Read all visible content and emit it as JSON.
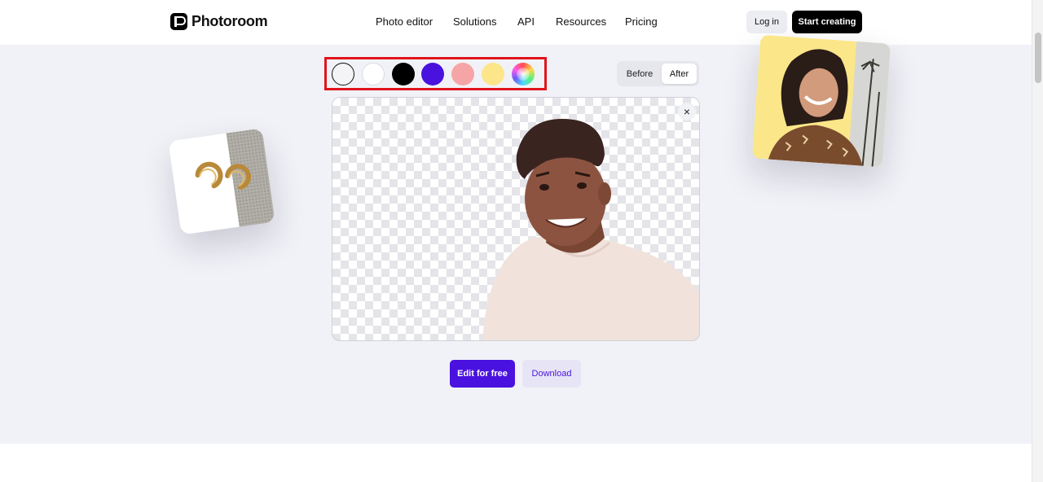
{
  "header": {
    "brand": "Photoroom",
    "nav": [
      "Photo editor",
      "Solutions",
      "API",
      "Resources",
      "Pricing"
    ],
    "login_label": "Log in",
    "start_label": "Start creating"
  },
  "editor": {
    "swatches": [
      {
        "name": "transparent",
        "color": "transparent"
      },
      {
        "name": "white",
        "color": "#ffffff"
      },
      {
        "name": "black",
        "color": "#000000"
      },
      {
        "name": "purple",
        "color": "#4a12df"
      },
      {
        "name": "pink",
        "color": "#f6a5a6"
      },
      {
        "name": "yellow",
        "color": "#fde68a"
      },
      {
        "name": "custom-color",
        "color": "rainbow"
      }
    ],
    "selected_swatch": "transparent",
    "toggle": {
      "before_label": "Before",
      "after_label": "After",
      "active": "After"
    },
    "close_icon": "×",
    "edit_label": "Edit for free",
    "download_label": "Download"
  },
  "colors": {
    "accent": "#4a12df",
    "highlight_box": "#e0151b",
    "hero_background": "#f1f2f7"
  }
}
